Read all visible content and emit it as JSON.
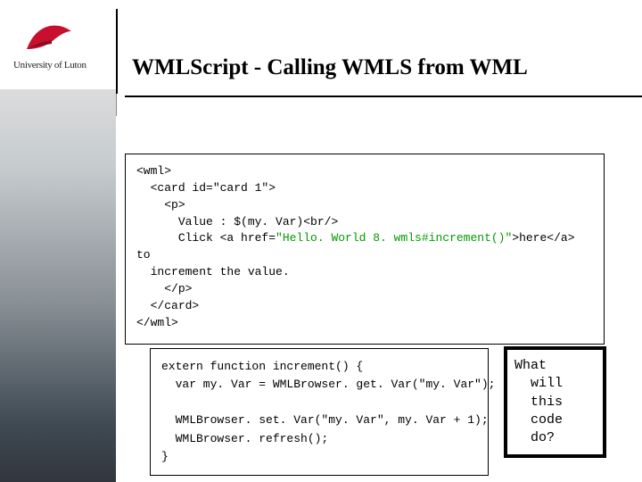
{
  "logo": {
    "text": "University of Luton"
  },
  "title": "WMLScript - Calling WMLS from WML",
  "code1": {
    "l1": "<wml>",
    "l2": "  <card id=\"card 1\">",
    "l3": "    <p>",
    "l4": "      Value : $(my. Var)<br/>",
    "l5a": "      Click <a href=",
    "l5b": "\"Hello. World 8. wmls#increment()\"",
    "l5c": ">here</a> to",
    "l6": "  increment the value.",
    "l7": "    </p>",
    "l8": "  </card>",
    "l9": "</wml>"
  },
  "code2": {
    "l1": "extern function increment() {",
    "l2": "  var my. Var = WMLBrowser. get. Var(\"my. Var\");",
    "l3": "",
    "l4": "  WMLBrowser. set. Var(\"my. Var\", my. Var + 1);",
    "l5": "  WMLBrowser. refresh();",
    "l6": "}"
  },
  "code3": {
    "l1": "What",
    "l2": "  will",
    "l3": "  this",
    "l4": "  code",
    "l5": "  do?"
  }
}
